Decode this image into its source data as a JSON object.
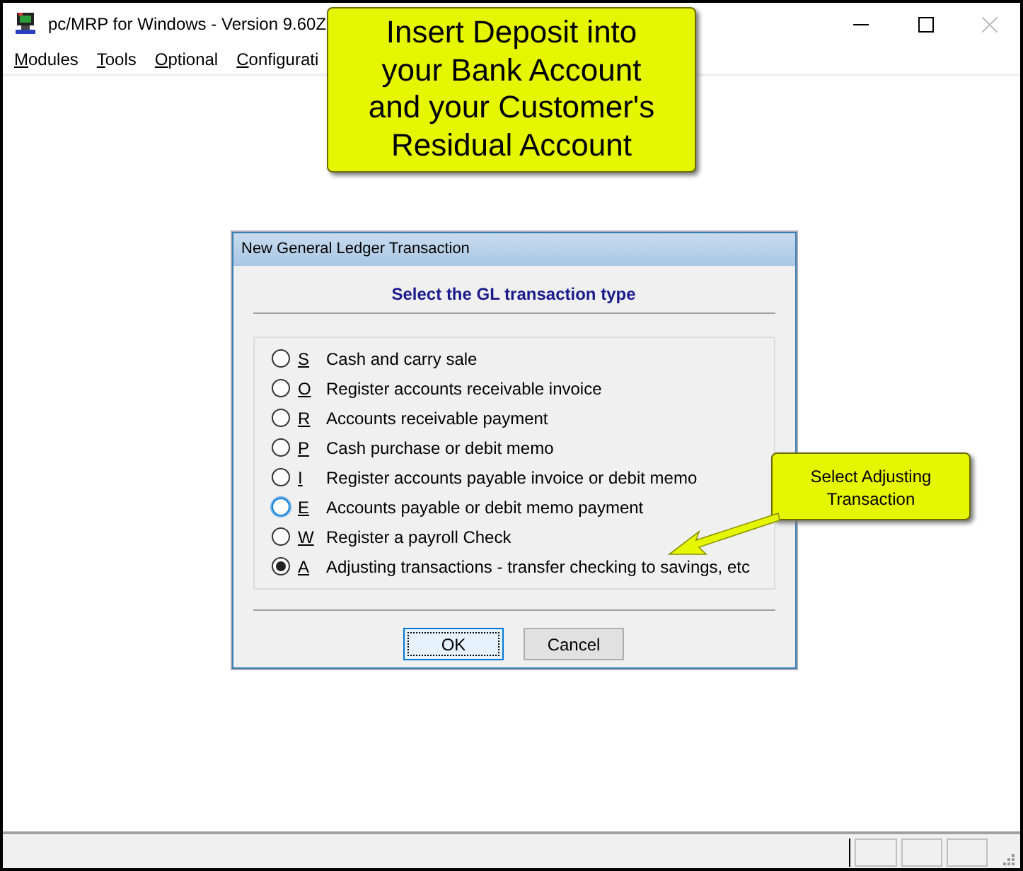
{
  "window": {
    "title": "pc/MRP for Windows - Version 9.60Z"
  },
  "menu": [
    "Modules",
    "Tools",
    "Optional",
    "Configurati"
  ],
  "callouts": [
    {
      "kind": "banner",
      "text": "Insert Deposit into your Bank Account and your Customer's Residual Account"
    },
    {
      "kind": "note",
      "text": "Select Adjusting Transaction"
    }
  ],
  "dialog": {
    "title": "New General Ledger Transaction",
    "heading": "Select the GL transaction type",
    "options": [
      {
        "key": "S",
        "label": "Cash and carry sale",
        "selected": false,
        "focused": false
      },
      {
        "key": "O",
        "label": "Register accounts receivable invoice",
        "selected": false,
        "focused": false
      },
      {
        "key": "R",
        "label": "Accounts receivable payment",
        "selected": false,
        "focused": false
      },
      {
        "key": "P",
        "label": "Cash purchase or debit memo",
        "selected": false,
        "focused": false
      },
      {
        "key": "I",
        "label": "Register accounts payable invoice or debit memo",
        "selected": false,
        "focused": false
      },
      {
        "key": "E",
        "label": "Accounts payable or debit memo payment",
        "selected": false,
        "focused": true
      },
      {
        "key": "W",
        "label": "Register a payroll Check",
        "selected": false,
        "focused": false
      },
      {
        "key": "A",
        "label": "Adjusting transactions - transfer checking to savings, etc",
        "selected": true,
        "focused": false
      }
    ],
    "buttons": [
      {
        "label": "OK",
        "default": true
      },
      {
        "label": "Cancel",
        "default": false
      }
    ]
  }
}
